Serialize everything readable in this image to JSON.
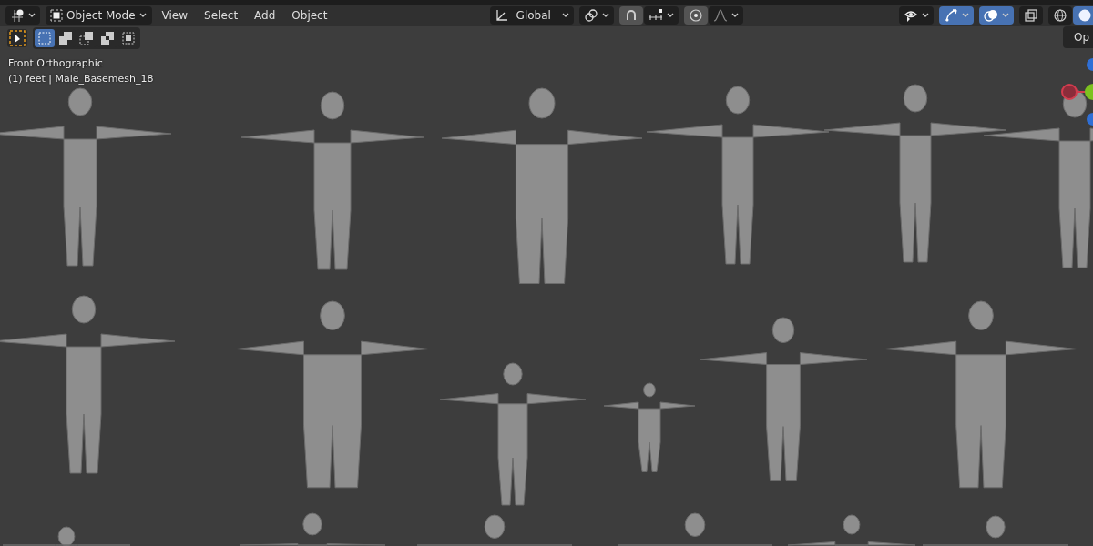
{
  "header": {
    "mode": {
      "label": "Object Mode"
    },
    "menus": [
      "View",
      "Select",
      "Add",
      "Object"
    ],
    "center_tools": [
      {
        "kind": "orientation",
        "label": "Global",
        "on": false
      },
      {
        "kind": "pivot",
        "on": false
      },
      {
        "kind": "snap",
        "on": true
      },
      {
        "kind": "snap_target",
        "on": false
      },
      {
        "kind": "proportional",
        "on": true
      },
      {
        "kind": "falloff",
        "on": false
      }
    ],
    "right_tools": [
      {
        "kind": "visibility",
        "on": false
      },
      {
        "kind": "gizmo",
        "on": true
      },
      {
        "kind": "overlay",
        "on": true
      },
      {
        "kind": "xray",
        "on": false
      },
      {
        "kind": "wireframe",
        "on": false
      },
      {
        "kind": "solid",
        "on": true
      }
    ]
  },
  "toolbar": {
    "active_tool": {
      "selected": true
    },
    "select_modes": [
      {
        "kind": "set",
        "selected": true
      },
      {
        "kind": "extend",
        "selected": false
      },
      {
        "kind": "subtract",
        "selected": false
      },
      {
        "kind": "invert",
        "selected": false
      },
      {
        "kind": "intersect",
        "selected": false
      }
    ]
  },
  "viewport": {
    "view_name": "Front Orthographic",
    "object_info": "(1) feet | Male_Basemesh_18",
    "side_button": "Op"
  }
}
